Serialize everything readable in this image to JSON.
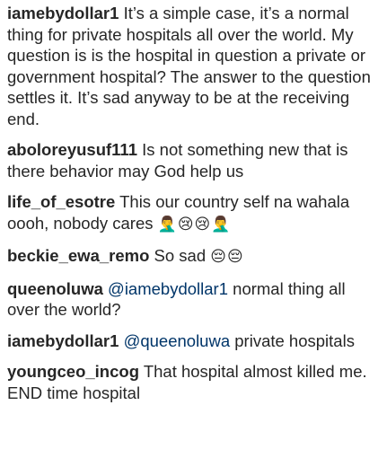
{
  "comments": [
    {
      "username": "iamebydollar1",
      "text": "It’s a simple case, it’s a normal thing for private hospitals all over the world. My question is is the hospital in question a private or government hospital? The answer to the question settles it. It’s sad anyway to be at the receiving end."
    },
    {
      "username": "aboloreyusuf111",
      "text": "Is not something new that is there behavior may God help us"
    },
    {
      "username": "life_of_esotre",
      "text": "This our country self na wahala oooh, nobody cares",
      "emoji": "🤦‍♂️😢😢🤦‍♂️"
    },
    {
      "username": "beckie_ewa_remo",
      "text": "So sad",
      "emoji": "😔😔"
    },
    {
      "username": "queenoluwa",
      "mention": "@iamebydollar1",
      "text": "normal thing all over the world?"
    },
    {
      "username": "iamebydollar1",
      "mention": "@queenoluwa",
      "text": "private hospitals"
    },
    {
      "username": "youngceo_incog",
      "text": "That hospital almost killed me. END time hospital"
    }
  ]
}
